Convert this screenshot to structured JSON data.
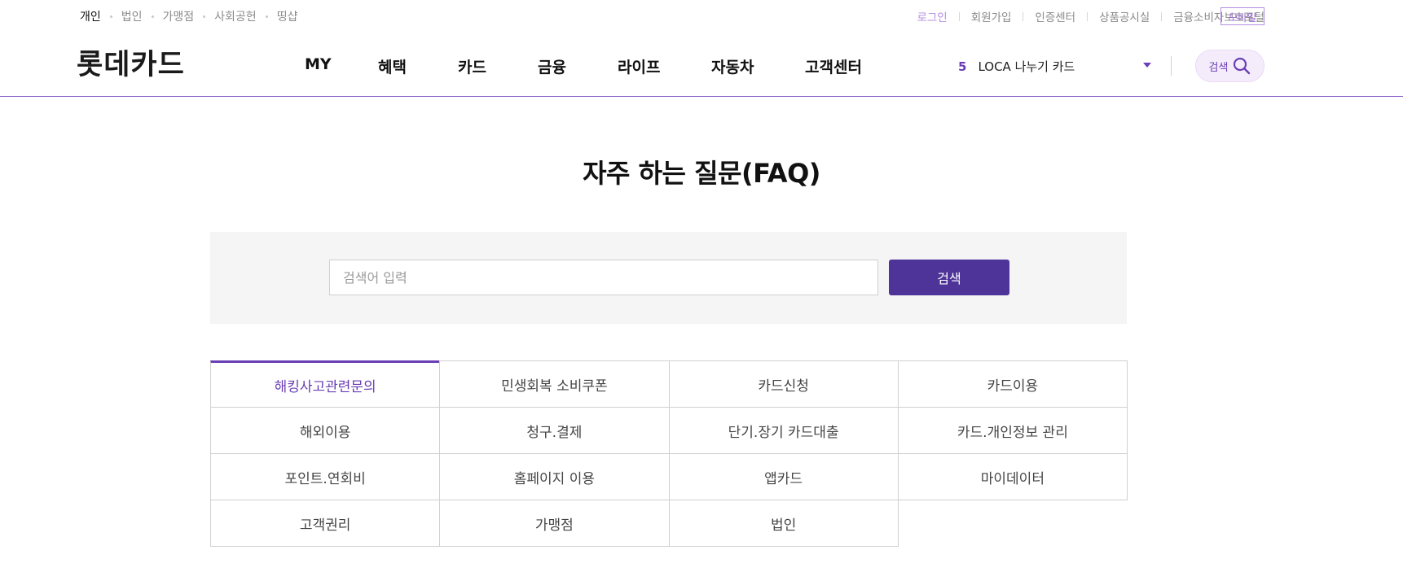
{
  "utility_nav": {
    "left": [
      "개인",
      "법인",
      "가맹점",
      "사회공헌",
      "띵샵"
    ],
    "active_index": 0,
    "right": [
      "로그인",
      "회원가입",
      "인증센터",
      "상품공시실",
      "금융소비자보호포털"
    ],
    "mobile": "모바일"
  },
  "header": {
    "logo": "롯데카드",
    "menu": [
      "MY",
      "혜택",
      "카드",
      "금융",
      "라이프",
      "자동차",
      "고객센터"
    ],
    "rolling": {
      "number": "5",
      "text": "LOCA 나누기 카드"
    },
    "search_button": "검색"
  },
  "page": {
    "title": "자주 하는 질문(FAQ)"
  },
  "search": {
    "placeholder": "검색어 입력",
    "value": "",
    "button": "검색"
  },
  "categories": {
    "active_index": 0,
    "items": [
      "해킹사고관련문의",
      "민생회복 소비쿠폰",
      "카드신청",
      "카드이용",
      "해외이용",
      "청구.결제",
      "단기.장기 카드대출",
      "카드.개인정보 관리",
      "포인트.연회비",
      "홈페이지 이용",
      "앱카드",
      "마이데이터",
      "고객권리",
      "가맹점",
      "법인"
    ]
  },
  "colors": {
    "accent": "#6a3fb5",
    "button": "#4e3498",
    "search_bg": "#f5f5f5",
    "pill_bg": "#f5ecfb"
  }
}
